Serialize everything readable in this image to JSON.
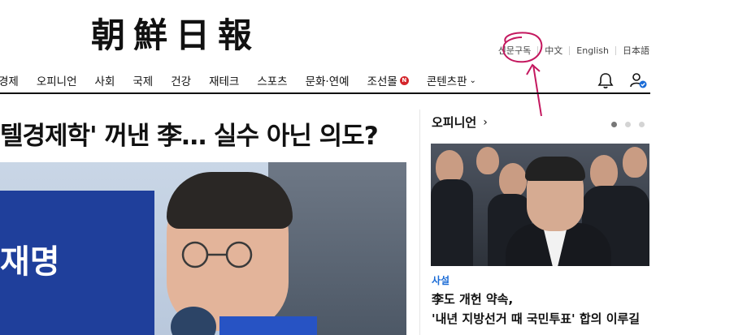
{
  "logo": {
    "chars": [
      "朝",
      "鮮",
      "日",
      "報"
    ]
  },
  "util_links": [
    "신문구독",
    "中文",
    "English",
    "日本語"
  ],
  "nav": {
    "items": [
      "경제",
      "오피니언",
      "사회",
      "국제",
      "건강",
      "재테크",
      "스포츠",
      "문화·연예",
      "조선몰",
      "콘텐츠판"
    ],
    "badge": "N"
  },
  "headline": "텔경제학' 꺼낸 李… 실수 아닌 의도?",
  "hero": {
    "banner_text": "재명"
  },
  "opinion": {
    "title": "오피니언",
    "arrow": "›",
    "category": "사설",
    "headline_line1": "李도 개헌 약속,",
    "headline_line2": "'내년 지방선거 때 국민투표' 합의 이루길"
  },
  "colors": {
    "accent": "#1a6bd6",
    "badge": "#d4252b",
    "annotation": "#c4185f"
  }
}
